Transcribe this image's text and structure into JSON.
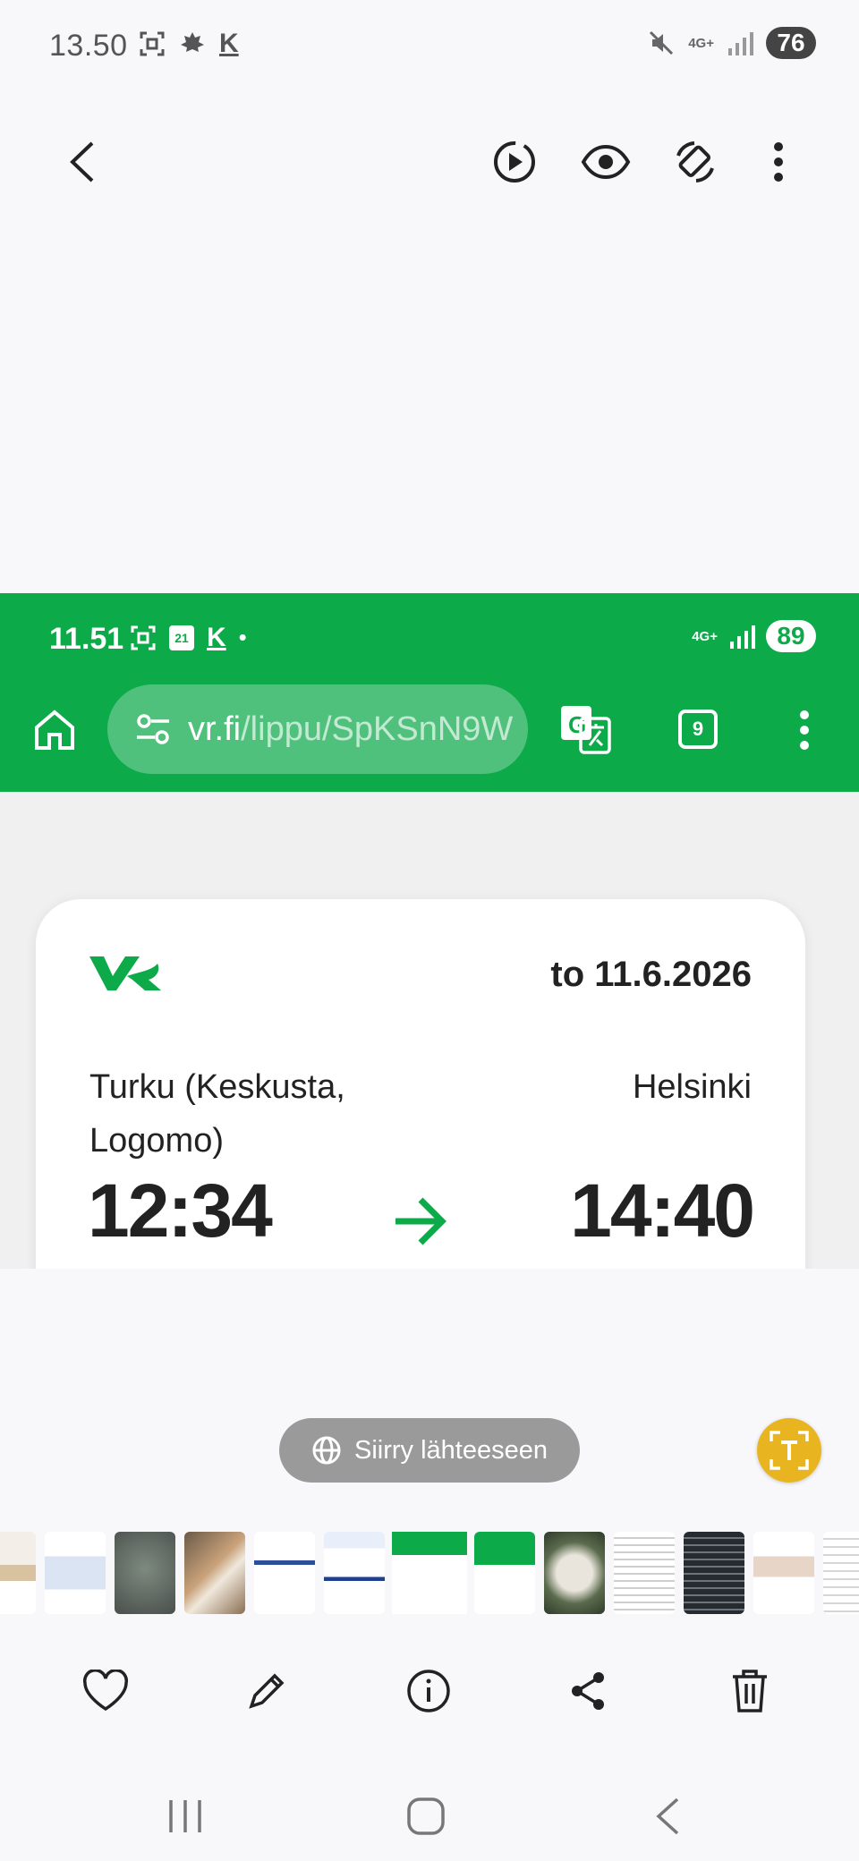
{
  "status_bar": {
    "time": "13.50",
    "k_icon": "K",
    "network": "4G+",
    "battery": "76"
  },
  "viewer_toolbar": {
    "icons": [
      "back-icon",
      "motion-photo-play-icon",
      "eye-icon",
      "rotate-icon",
      "more-icon"
    ]
  },
  "screenshot": {
    "status_bar": {
      "time": "11.51",
      "calendar_day": "21",
      "k_icon": "K",
      "dot": "•",
      "network": "4G+",
      "battery": "89"
    },
    "browser": {
      "url_host": "vr.fi",
      "url_path": "/lippu/SpKSnN9W",
      "tab_count": "9"
    },
    "ticket": {
      "logo": "VR",
      "date": "to 11.6.2026",
      "from_station": "Turku (Keskusta, Logomo)",
      "to_station": "Helsinki",
      "departure_time": "12:34",
      "arrival_time": "14:40"
    },
    "colors": {
      "brand_green": "#0daa4a"
    }
  },
  "source_button": {
    "label": "Siirry lähteeseen"
  },
  "actions": [
    "favorite-icon",
    "edit-icon",
    "info-icon",
    "share-icon",
    "delete-icon"
  ],
  "nav": [
    "recents-icon",
    "home-icon",
    "back-icon"
  ]
}
